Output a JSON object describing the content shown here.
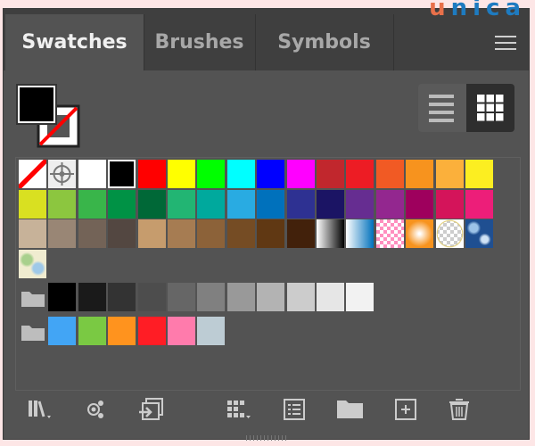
{
  "logo": "unica",
  "tabs": [
    {
      "label": "Swatches",
      "active": true
    },
    {
      "label": "Brushes",
      "active": false
    },
    {
      "label": "Symbols",
      "active": false
    }
  ],
  "fill_color": "#000000",
  "stroke": "none",
  "view_mode": "thumbnail",
  "swatches": [
    "none",
    "registration",
    "#ffffff",
    "#000000",
    "#ff0000",
    "#ffff00",
    "#00ff00",
    "#00ffff",
    "#0000ff",
    "#ff00ff",
    "#c1272d",
    "#ed1c24",
    "#f15a24",
    "#f7931e",
    "#fbb03b",
    "#fcee21",
    "#d9e021",
    "#8cc63f",
    "#39b54a",
    "#009245",
    "#006837",
    "#22b573",
    "#00a99d",
    "#29abe2",
    "#0071bc",
    "#2e3192",
    "#1b1464",
    "#662d91",
    "#93278f",
    "#9e005d",
    "#d4145a",
    "#ed1e79",
    "#c7b299",
    "#998675",
    "#736357",
    "#534741",
    "#c69c6d",
    "#a67c52",
    "#8c6239",
    "#754c24",
    "#603813",
    "#42210b",
    "gradient-bw",
    "gradient-blue",
    "pattern-pink-checker",
    "gradient-orange-radial",
    "pattern-transparent-ellipse",
    "pattern-blue-floral",
    "pattern-pastel"
  ],
  "groups": [
    {
      "icon": "folder-icon",
      "colors": [
        "#000000",
        "#1a1a1a",
        "#333333",
        "#4d4d4d",
        "#666666",
        "#808080",
        "#999999",
        "#b3b3b3",
        "#cccccc",
        "#e6e6e6",
        "#f2f2f2"
      ]
    },
    {
      "icon": "folder-icon",
      "colors": [
        "#42a5f5",
        "#7ac943",
        "#ff931e",
        "#ff1d25",
        "#ff7bac",
        "#bdccd4"
      ]
    }
  ],
  "toolbar": [
    "swatch-libraries",
    "place-swatches",
    "import-swatches",
    "show-swatch-kinds",
    "swatch-options",
    "new-color-group",
    "new-swatch",
    "delete-swatch"
  ]
}
